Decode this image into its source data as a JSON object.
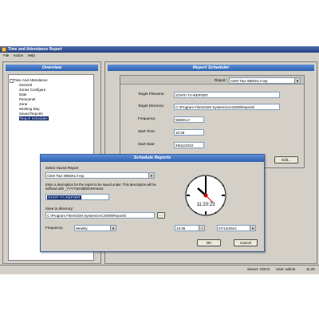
{
  "window": {
    "title": "Time and Attendance Report"
  },
  "menu": [
    "File",
    "Action",
    "Help"
  ],
  "overview": {
    "header": "Overview",
    "tree": [
      {
        "label": "Time And Attendance",
        "level": 0,
        "selected": false
      },
      {
        "label": "General",
        "level": 1,
        "selected": false
      },
      {
        "label": "Zones Configure",
        "level": 1,
        "selected": false
      },
      {
        "label": "Date",
        "level": 1,
        "selected": false
      },
      {
        "label": "Personnel",
        "level": 1,
        "selected": false
      },
      {
        "label": "Zone",
        "level": 1,
        "selected": false
      },
      {
        "label": "Working Day",
        "level": 1,
        "selected": false
      },
      {
        "label": "Saved Reports",
        "level": 1,
        "selected": false
      },
      {
        "label": "Report Scheduler",
        "level": 1,
        "selected": true
      }
    ]
  },
  "scheduler": {
    "header": "Report Scheduler",
    "report_label": "Report :",
    "report_value": "CEM T&A WEEKLY.rep",
    "target_filename_label": "Target Filename:",
    "target_filename": "STAFF-TA-REPORT",
    "target_directory_label": "Target Directory:",
    "target_directory": "C:\\Program Files\\CEM Systems\\AC2000\\Reports\\",
    "frequency_label": "Frequency:",
    "frequency": "WEEKLY",
    "start_time_label": "Start Time:",
    "start_time": "10:35",
    "start_date_label": "Start Date:",
    "start_date": "29/11/2010",
    "edit_button": "Edit..."
  },
  "dialog": {
    "title": "Schedule Reports",
    "select_label": "Select Saved Report",
    "select_value": "CEM T&A WEEKLY.rep",
    "description_text": "Enter a description for the report to be saved under.  This description will be suffixed with _YYYYmmddDDHHmmss",
    "description_value": "STAFF-TA-REPORT",
    "save_dir_label": "Save to directory:",
    "save_dir_value": "C:\\Program Files\\CEM Systems\\AC2000\\Reports\\",
    "browse_button": "...",
    "frequency_label": "Frequency:",
    "frequency_value": "Weekly",
    "clock_time": "11:20:23",
    "time_value": "10:35",
    "date_value": "07/12/2010",
    "ok_button": "OK",
    "cancel_button": "Cancel"
  },
  "status": {
    "server": "Server: CDC0",
    "user": "User: admin",
    "time": "11:20"
  }
}
